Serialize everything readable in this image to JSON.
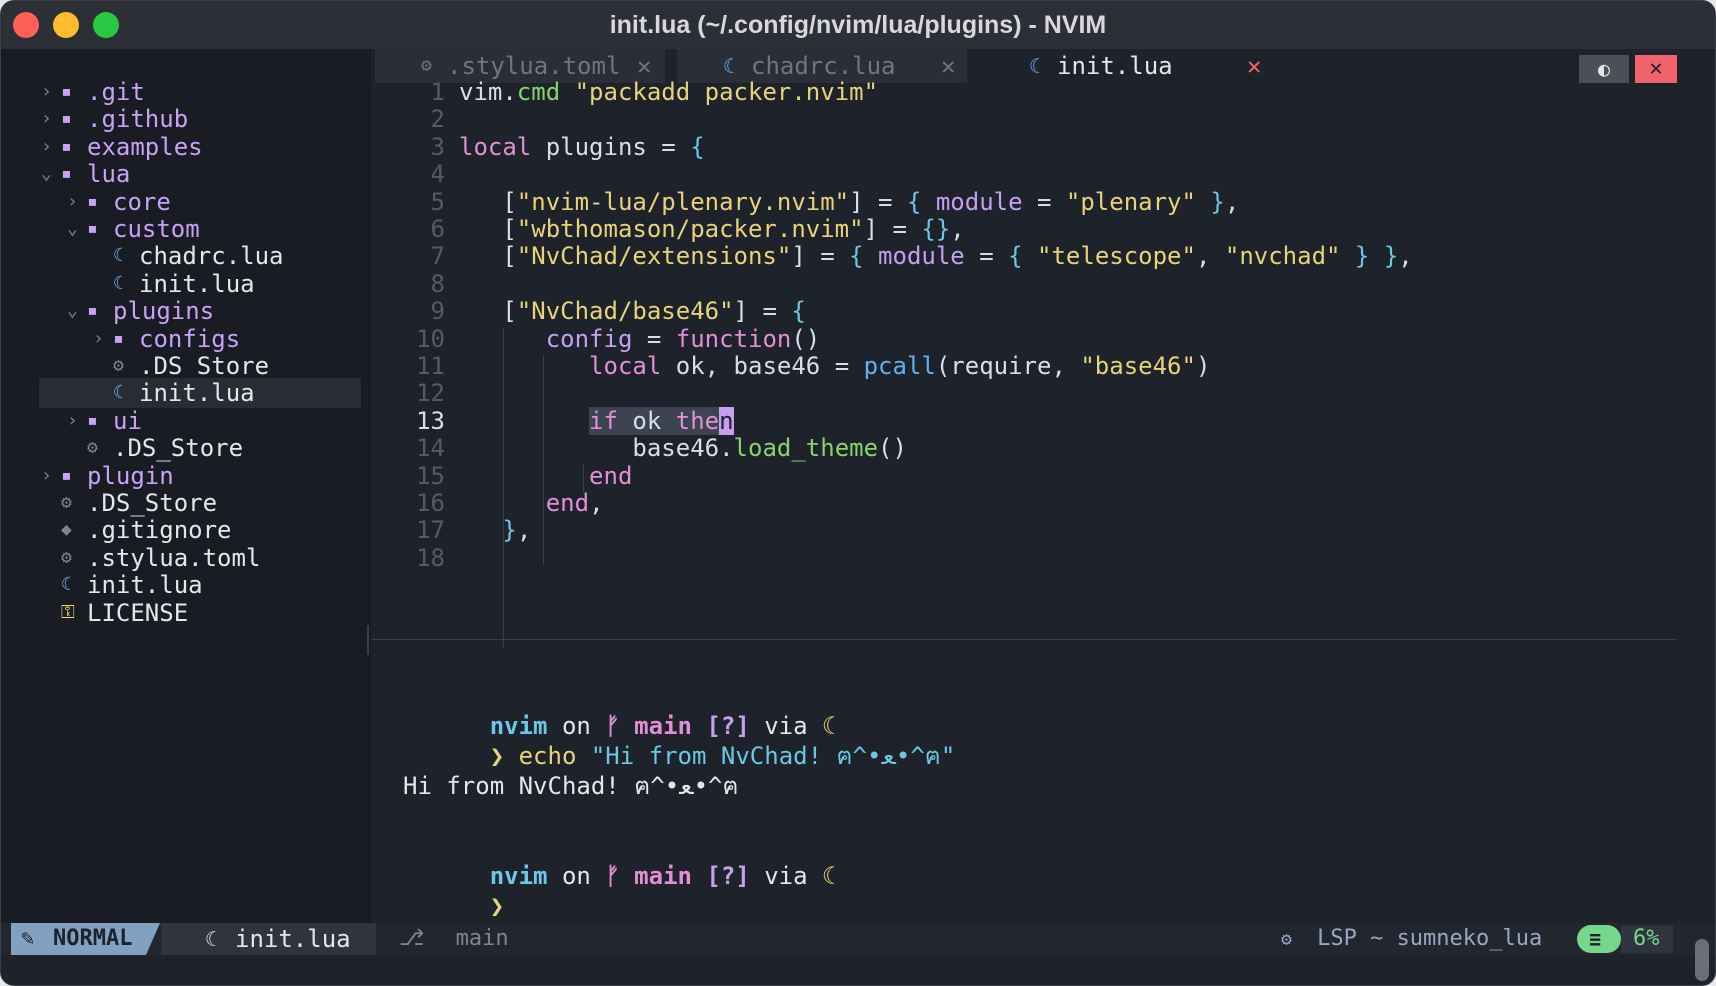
{
  "window": {
    "title": "init.lua (~/.config/nvim/lua/plugins) - NVIM"
  },
  "colors": {
    "accent": "#81a1c1",
    "folder": "#c7a2f7",
    "close": "#f0636b",
    "lsp": "#76d68c"
  },
  "tree": [
    {
      "name": ".git",
      "kind": "folder",
      "chev": "›",
      "icon": "▪"
    },
    {
      "name": ".github",
      "kind": "folder",
      "chev": "›",
      "icon": "▪"
    },
    {
      "name": "examples",
      "kind": "folder",
      "chev": "›",
      "icon": "▪"
    },
    {
      "name": "lua",
      "kind": "folder",
      "chev": "⌄",
      "icon": "▪"
    },
    {
      "name": "core",
      "kind": "folder",
      "chev": "›",
      "icon": "▪"
    },
    {
      "name": "custom",
      "kind": "folder",
      "chev": "⌄",
      "icon": "▪"
    },
    {
      "name": "chadrc.lua",
      "kind": "file",
      "chev": "",
      "icon": "☾"
    },
    {
      "name": "init.lua",
      "kind": "file",
      "chev": "",
      "icon": "☾"
    },
    {
      "name": "plugins",
      "kind": "folder",
      "chev": "⌄",
      "icon": "▪"
    },
    {
      "name": "configs",
      "kind": "folder",
      "chev": "›",
      "icon": "▪"
    },
    {
      "name": ".DS_Store",
      "kind": "file",
      "chev": "",
      "icon": "⚙"
    },
    {
      "name": "init.lua",
      "kind": "file",
      "chev": "",
      "icon": "☾"
    },
    {
      "name": "ui",
      "kind": "folder",
      "chev": "›",
      "icon": "▪"
    },
    {
      "name": ".DS_Store",
      "kind": "file",
      "chev": "",
      "icon": "⚙"
    },
    {
      "name": "plugin",
      "kind": "folder",
      "chev": "›",
      "icon": "▪"
    },
    {
      "name": ".DS_Store",
      "kind": "file",
      "chev": "",
      "icon": "⚙"
    },
    {
      "name": ".gitignore",
      "kind": "file",
      "chev": "",
      "icon": "◆"
    },
    {
      "name": ".stylua.toml",
      "kind": "file",
      "chev": "",
      "icon": "⚙"
    },
    {
      "name": "init.lua",
      "kind": "file",
      "chev": "",
      "icon": "☾"
    },
    {
      "name": "LICENSE",
      "kind": "file",
      "chev": "",
      "icon": "⚿"
    }
  ],
  "tabs": [
    {
      "label": ".stylua.toml",
      "icon": "⚙",
      "close": "✕"
    },
    {
      "label": "chadrc.lua",
      "icon": "☾",
      "close": "✕"
    },
    {
      "label": "init.lua",
      "icon": "☾",
      "close": "✕"
    }
  ],
  "tab_buttons": {
    "toggle": "◐",
    "close": "✕"
  },
  "editor": {
    "line_numbers": [
      "1",
      "2",
      "3",
      "4",
      "5",
      "6",
      "7",
      "8",
      "9",
      "10",
      "11",
      "12",
      "13",
      "14",
      "15",
      "16",
      "17",
      "18"
    ],
    "code": [
      "vim.cmd \"packadd packer.nvim\"",
      "",
      "local plugins = {",
      "",
      "   [\"nvim-lua/plenary.nvim\"] = { module = \"plenary\" },",
      "   [\"wbthomason/packer.nvim\"] = {},",
      "   [\"NvChad/extensions\"] = { module = { \"telescope\", \"nvchad\" } },",
      "",
      "   [\"NvChad/base46\"] = {",
      "      config = function()",
      "         local ok, base46 = pcall(require, \"base46\")",
      "",
      "         if ok then",
      "            base46.load_theme()",
      "         end",
      "      end,",
      "   },",
      ""
    ]
  },
  "terminal": {
    "prompt_dir": "nvim",
    "prompt_on": "on",
    "prompt_branch_icon": "ᚠ",
    "prompt_branch": "main",
    "prompt_status": "[?]",
    "prompt_via": "via",
    "prompt_moon": "☾",
    "prompt_arrow": "❯",
    "command_name": "echo",
    "command_arg": "\"Hi from NvChad! ฅ^•ﻌ•^ฅ\"",
    "output": "Hi from NvChad! ฅ^•ﻌ•^ฅ"
  },
  "statusline": {
    "mode_icon": "✎",
    "mode": "NORMAL",
    "file_icon": "☾",
    "file": "init.lua",
    "branch_icon": "⎇",
    "branch": "main",
    "lsp_icon": "⚙",
    "lsp": "LSP ~ sumneko_lua",
    "percent_icon": "≡",
    "percent": "6%"
  }
}
